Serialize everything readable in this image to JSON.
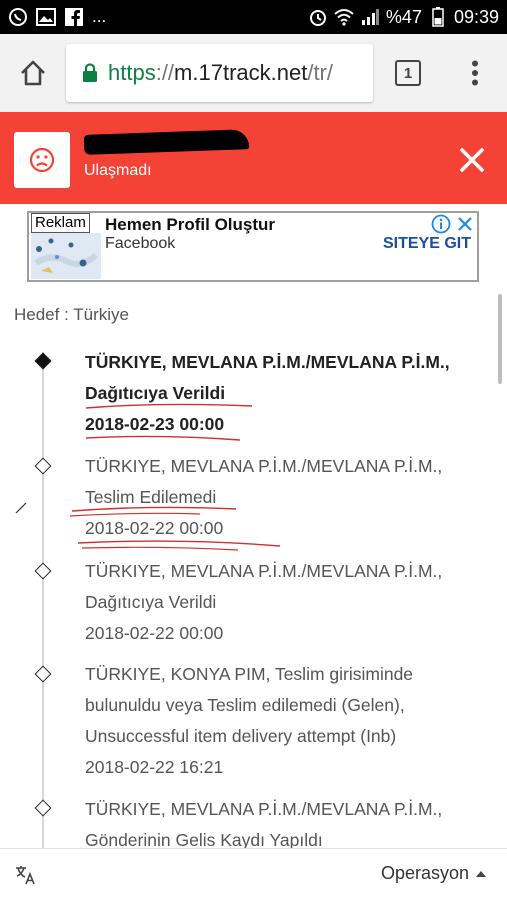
{
  "statusbar": {
    "left_icons": [
      "whatsapp-icon",
      "image-icon",
      "facebook-icon"
    ],
    "more": "...",
    "battery": "%47",
    "time": "09:39"
  },
  "browser": {
    "url_scheme": "https",
    "url_sep": "://",
    "url_host": "m.17track.net",
    "url_path": "/tr/",
    "tab_count": "1"
  },
  "banner": {
    "status": "Ulaşmadı",
    "bg_color": "#f44336"
  },
  "ad": {
    "tag": "Reklam",
    "title": "Hemen Profil Oluştur",
    "advertiser": "Facebook",
    "cta": "SITEYE GIT"
  },
  "destination": "Hedef : Türkiye",
  "events": [
    {
      "location": "TÜRKIYE, MEVLANA P.İ.M./MEVLANA P.İ.M.,",
      "desc": "Dağıtıcıya Verildi",
      "date": "2018-02-23 00:00"
    },
    {
      "location": "TÜRKIYE, MEVLANA P.İ.M./MEVLANA P.İ.M.,",
      "desc": "Teslim Edilemedi",
      "date": "2018-02-22 00:00"
    },
    {
      "location": "TÜRKIYE, MEVLANA P.İ.M./MEVLANA P.İ.M.,",
      "desc": "Dağıtıcıya Verildi",
      "date": "2018-02-22 00:00"
    },
    {
      "location": "TÜRKIYE, KONYA PIM, Teslim girisiminde",
      "desc": "bulunuldu veya Teslim edilemedi (Gelen),",
      "desc2": "Unsuccessful item delivery attempt (Inb)",
      "date": "2018-02-22 16:21"
    },
    {
      "location": "TÜRKIYE, MEVLANA P.İ.M./MEVLANA P.İ.M.,",
      "desc": "Gönderinin Gelis Kaydı Yapıldı"
    }
  ],
  "bottom": {
    "operation_label": "Operasyon"
  }
}
